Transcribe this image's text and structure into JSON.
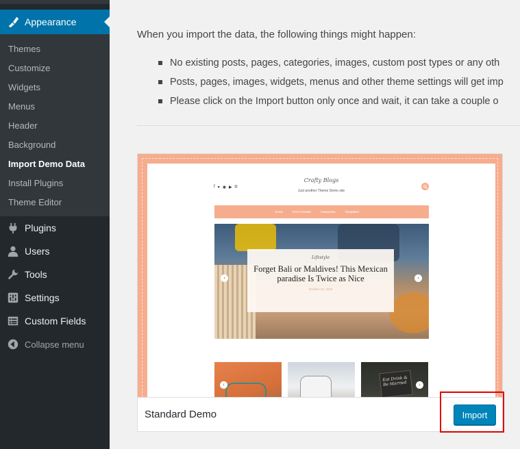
{
  "sidebar": {
    "current": {
      "label": "Appearance",
      "icon": "paintbrush-icon"
    },
    "submenu": [
      {
        "label": "Themes"
      },
      {
        "label": "Customize"
      },
      {
        "label": "Widgets"
      },
      {
        "label": "Menus"
      },
      {
        "label": "Header"
      },
      {
        "label": "Background"
      },
      {
        "label": "Import Demo Data",
        "current": true
      },
      {
        "label": "Install Plugins"
      },
      {
        "label": "Theme Editor"
      }
    ],
    "menu": [
      {
        "label": "Plugins",
        "icon": "plugin-icon"
      },
      {
        "label": "Users",
        "icon": "user-icon"
      },
      {
        "label": "Tools",
        "icon": "wrench-icon"
      },
      {
        "label": "Settings",
        "icon": "settings-icon"
      },
      {
        "label": "Custom Fields",
        "icon": "list-icon"
      },
      {
        "label": "Collapse menu",
        "icon": "collapse-icon"
      }
    ]
  },
  "main": {
    "intro": "When you import the data, the following things might happen:",
    "bullets": [
      "No existing posts, pages, categories, images, custom post types or any oth",
      "Posts, pages, images, widgets, menus and other theme settings will get imp",
      "Please click on the Import button only once and wait, it can take a couple o"
    ]
  },
  "demo": {
    "name": "Standard Demo",
    "import_label": "Import",
    "preview": {
      "site_title": "Crafty Blogs",
      "tagline": "Just another Theme Demo site",
      "nav": [
        "Home",
        "Post Formats",
        "Categories",
        "Templates"
      ],
      "hero_category": "Lifestyle",
      "hero_title": "Forget Bali or Maldives! This Mexican paradise Is Twice as Nice",
      "hero_date": "October 24, 2018",
      "thumb3_text": "Eat Drink & Be Married"
    }
  },
  "colors": {
    "sidebar_bg": "#23282d",
    "submenu_bg": "#32373c",
    "current_bg": "#0073aa",
    "accent_peach": "#f6ad8d",
    "button_blue": "#0085ba",
    "highlight_red": "#e00000"
  }
}
